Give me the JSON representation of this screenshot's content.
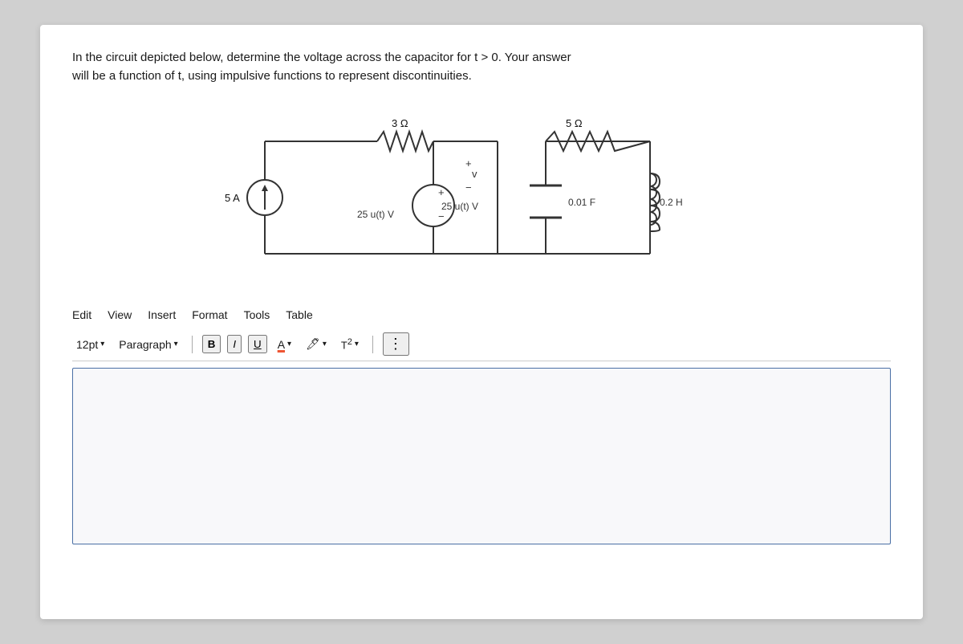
{
  "problem": {
    "line1": "In the circuit depicted below, determine the voltage across the capacitor for t > 0. Your answer",
    "line2": "will be a function of t, using impulsive functions to represent discontinuities."
  },
  "circuit": {
    "current_source": "5 A",
    "resistor1": "3 Ω",
    "voltage_source": "25 u(t) V",
    "capacitor": "0.01 F",
    "resistor2": "5 Ω",
    "inductor": "0.2 H",
    "voltage_label": "v",
    "plus": "+",
    "minus": "−"
  },
  "menu": {
    "edit": "Edit",
    "view": "View",
    "insert": "Insert",
    "format": "Format",
    "tools": "Tools",
    "table": "Table"
  },
  "toolbar": {
    "font_size": "12pt",
    "paragraph": "Paragraph",
    "bold": "B",
    "italic": "I",
    "underline": "U",
    "color_a": "A",
    "highlight": "🖊",
    "superscript": "T²",
    "more": "⋮"
  },
  "answer_box": {
    "placeholder": ""
  }
}
